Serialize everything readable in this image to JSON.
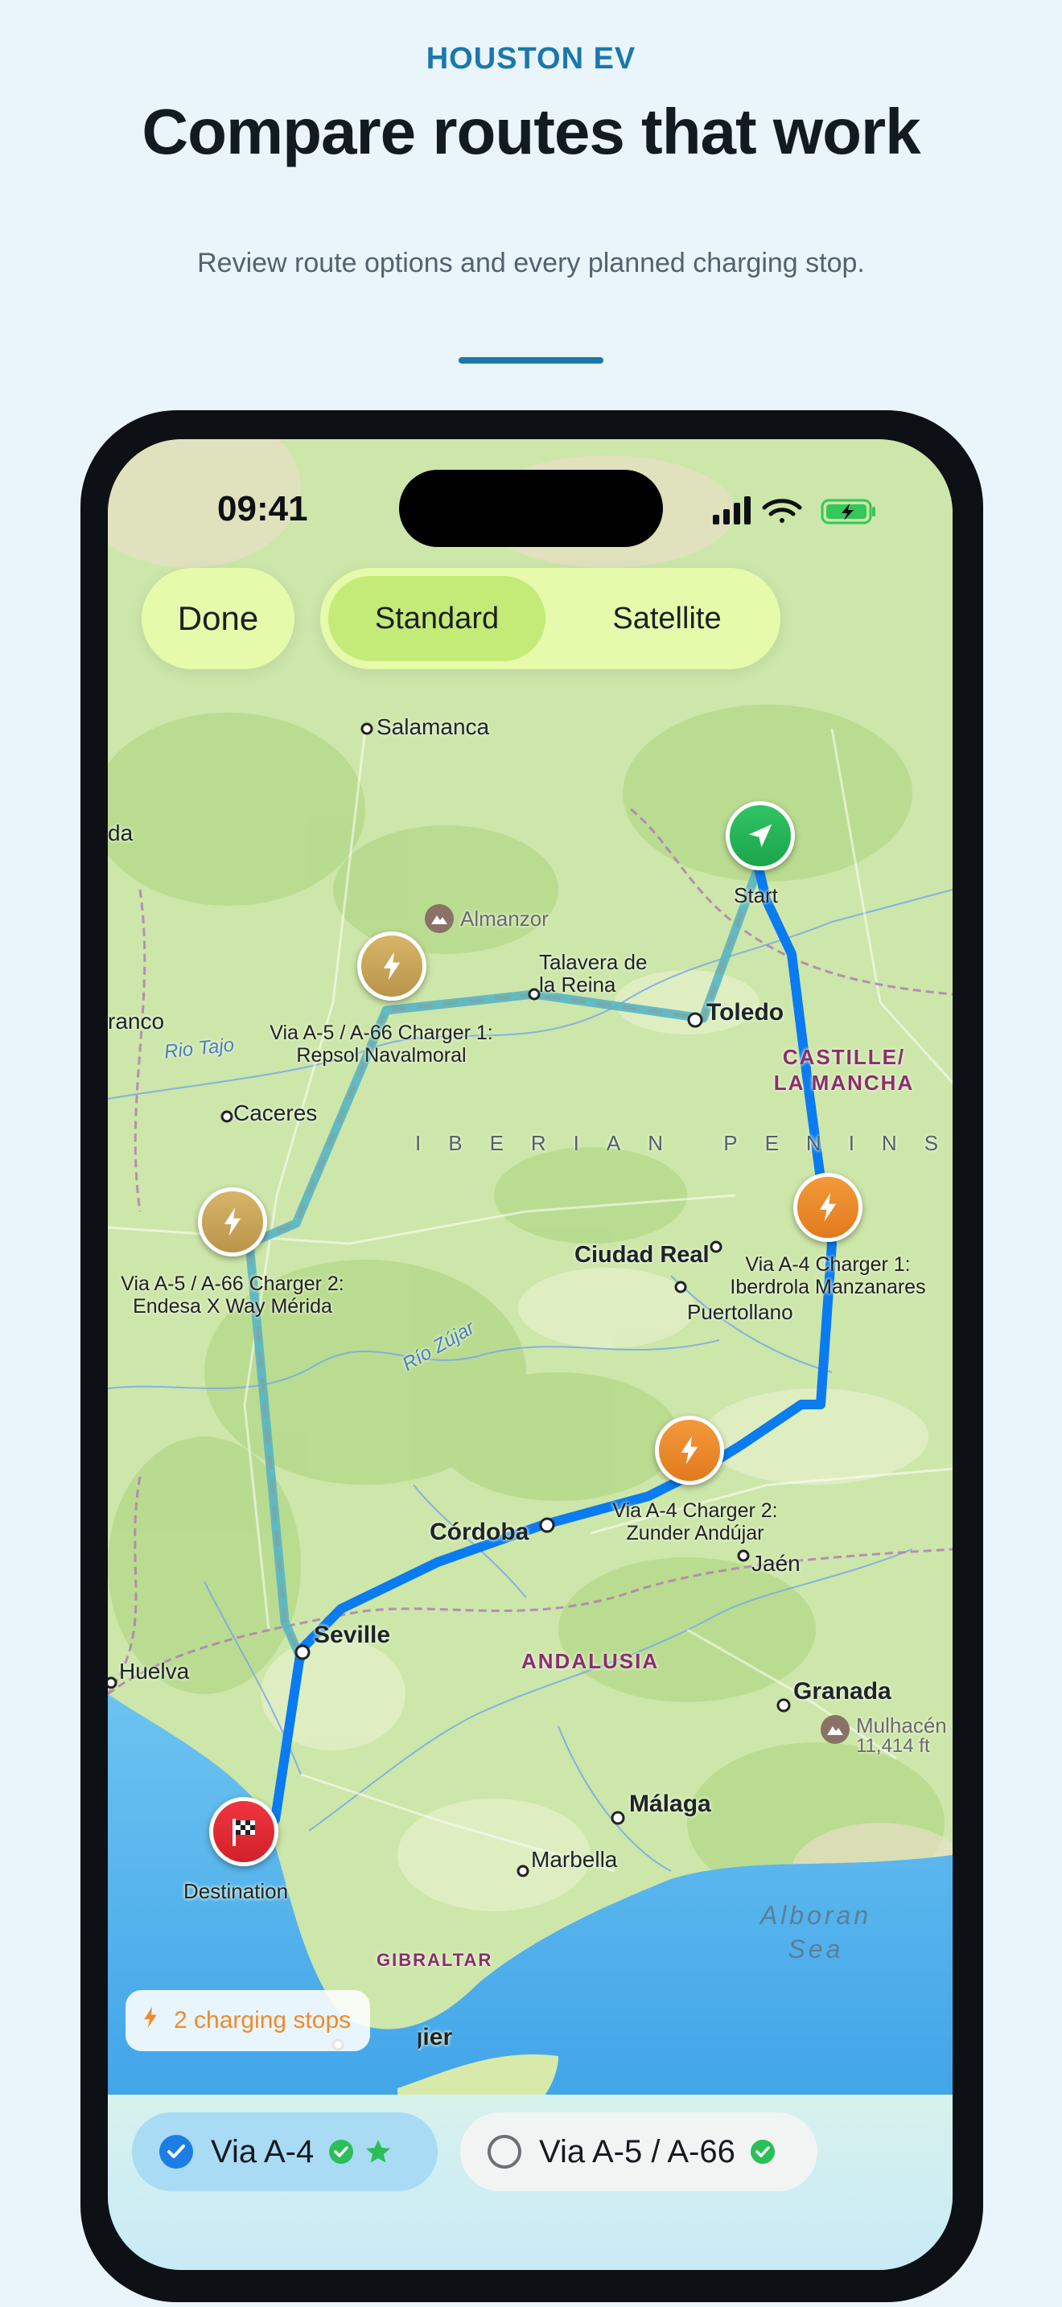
{
  "header": {
    "eyebrow": "HOUSTON EV",
    "title": "Compare routes that work",
    "subtitle": "Review route options and every planned charging stop."
  },
  "status_bar": {
    "time": "09:41"
  },
  "map_controls": {
    "done_label": "Done",
    "map_types": [
      {
        "label": "Standard",
        "selected": true
      },
      {
        "label": "Satellite",
        "selected": false
      }
    ]
  },
  "map": {
    "cities": {
      "salamanca": "Salamanca",
      "caceres": "Caceres",
      "talavera": "Talavera de la Reina",
      "toledo": "Toledo",
      "ciudad_real": "Ciudad Real",
      "puertollano": "Puertollano",
      "cordoba": "Córdoba",
      "jaen": "Jaén",
      "seville": "Seville",
      "huelva": "Huelva",
      "granada": "Granada",
      "malaga": "Málaga",
      "marbella": "Marbella",
      "tangier": "Tangier",
      "left_edge_1": "da",
      "left_edge_2": "ranco"
    },
    "regions": {
      "castilla": "CASTILLE/ LA MANCHA",
      "andalusia": "ANDALUSIA",
      "gibraltar": "GIBRALTAR",
      "peninsula": "IBERIAN PENINS"
    },
    "water": {
      "alboran": "Alboran Sea",
      "rio_tajo": "Rio Tajo",
      "rio_zujar": "Río Zújar"
    },
    "peaks": {
      "almanzor": "Almanzor",
      "mulhacen": "Mulhacén",
      "mulhacen_elevation": "11,414 ft"
    },
    "markers": {
      "start": {
        "label": "Start",
        "icon": "location-arrow-icon",
        "color": "#22b656"
      },
      "destination": {
        "label": "Destination",
        "icon": "checkered-flag-icon",
        "color": "#e02a33"
      },
      "charger_a4_1": {
        "label": "Via A-4 Charger 1: Iberdrola Manzanares",
        "icon": "lightning-icon",
        "color": "#ec8428"
      },
      "charger_a4_2": {
        "label": "Via A-4 Charger 2: Zunder Andújar",
        "icon": "lightning-icon",
        "color": "#ec8428"
      },
      "charger_a5_1": {
        "label": "Via A-5 / A-66 Charger 1: Repsol Navalmoral",
        "icon": "lightning-icon",
        "color": "#c9a55a"
      },
      "charger_a5_2": {
        "label": "Via A-5 / A-66 Charger 2: Endesa X Way Mérida",
        "icon": "lightning-icon",
        "color": "#c9a55a"
      }
    },
    "route_colors": {
      "primary": "#0a7bf0",
      "alternate": "#57b5c4"
    }
  },
  "charging_summary": {
    "text": "2 charging stops",
    "icon": "lightning-icon",
    "color": "#ee8b2c"
  },
  "routes": [
    {
      "label": "Via A-4",
      "selected": true,
      "badges": [
        "check-circle-icon",
        "star-icon"
      ]
    },
    {
      "label": "Via A-5 / A-66",
      "selected": false,
      "badges": [
        "check-circle-icon"
      ]
    }
  ],
  "accent_color": "#1a78aa"
}
